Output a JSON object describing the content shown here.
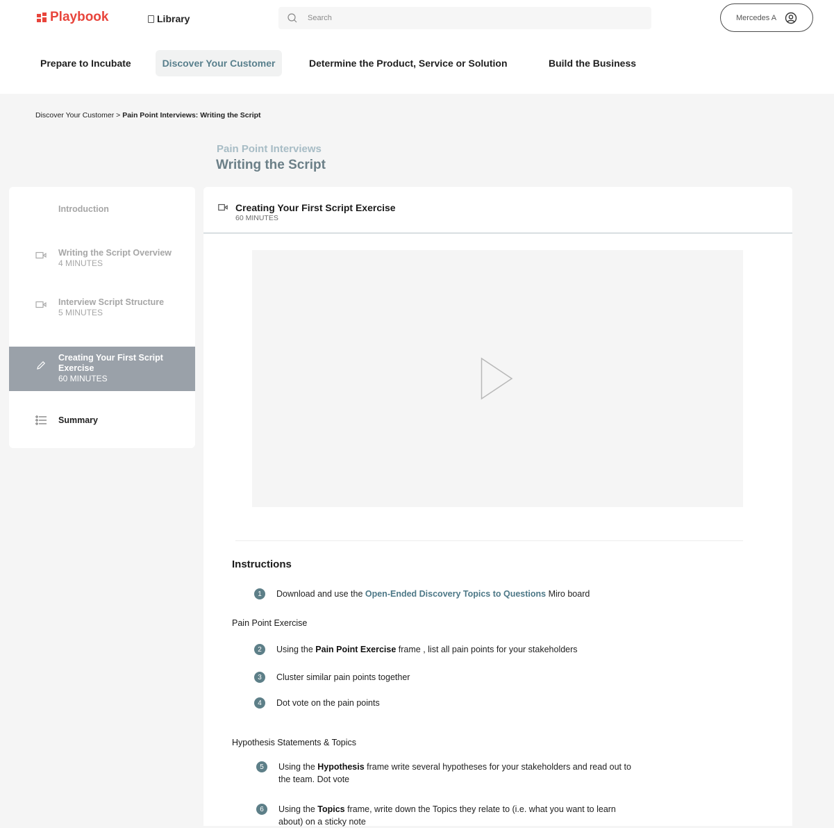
{
  "header": {
    "brand": "Playbook",
    "library": "Library",
    "search_placeholder": "Search",
    "user_name": "Mercedes A"
  },
  "tabs": [
    {
      "label": "Prepare to Incubate"
    },
    {
      "label": "Discover Your Customer"
    },
    {
      "label": "Determine the Product, Service or Solution"
    },
    {
      "label": "Build the Business"
    }
  ],
  "breadcrumb": {
    "parent": "Discover Your Customer",
    "separator": " > ",
    "current": "Pain Point Interviews: Writing the Script"
  },
  "page": {
    "subtitle": "Pain Point Interviews",
    "title": "Writing the Script"
  },
  "sidebar": {
    "items": [
      {
        "title": "Introduction",
        "duration": ""
      },
      {
        "title": "Writing the Script Overview",
        "duration": "4 MINUTES"
      },
      {
        "title": "Interview Script Structure",
        "duration": "5 MINUTES"
      },
      {
        "title_line1": "Creating Your First Script",
        "title_line2": "Exercise",
        "duration": "60 MINUTES"
      },
      {
        "title": "Summary",
        "duration": ""
      }
    ]
  },
  "lesson": {
    "title": "Creating Your First Script Exercise",
    "duration": "60 MINUTES"
  },
  "instructions": {
    "title": "Instructions",
    "section1": "Pain Point Exercise",
    "section2": "Hypothesis Statements & Topics",
    "steps": [
      {
        "num": "1",
        "pre": "Download and use the ",
        "link": "Open-Ended Discovery Topics to Questions",
        "post": " Miro board"
      },
      {
        "num": "2",
        "pre": "Using the ",
        "bold": "Pain Point Exercise",
        "post": " frame , list all pain points for your stakeholders"
      },
      {
        "num": "3",
        "text": "Cluster similar pain points together"
      },
      {
        "num": "4",
        "text": "Dot vote on the pain points"
      },
      {
        "num": "5",
        "pre": "Using the ",
        "bold": "Hypothesis",
        "post": " frame write several hypotheses for your stakeholders and read out to",
        "post2": "the team. Dot vote"
      },
      {
        "num": "6",
        "pre": "Using the ",
        "bold": "Topics",
        "post": " frame, write down the Topics they relate to (i.e. what you want to learn",
        "post2": "about) on a sticky note"
      }
    ]
  },
  "colors": {
    "brand": "#e8453c",
    "accent": "#587f8c",
    "active_sidebar": "#9aa1a9",
    "step_badge": "#5d7f88"
  }
}
